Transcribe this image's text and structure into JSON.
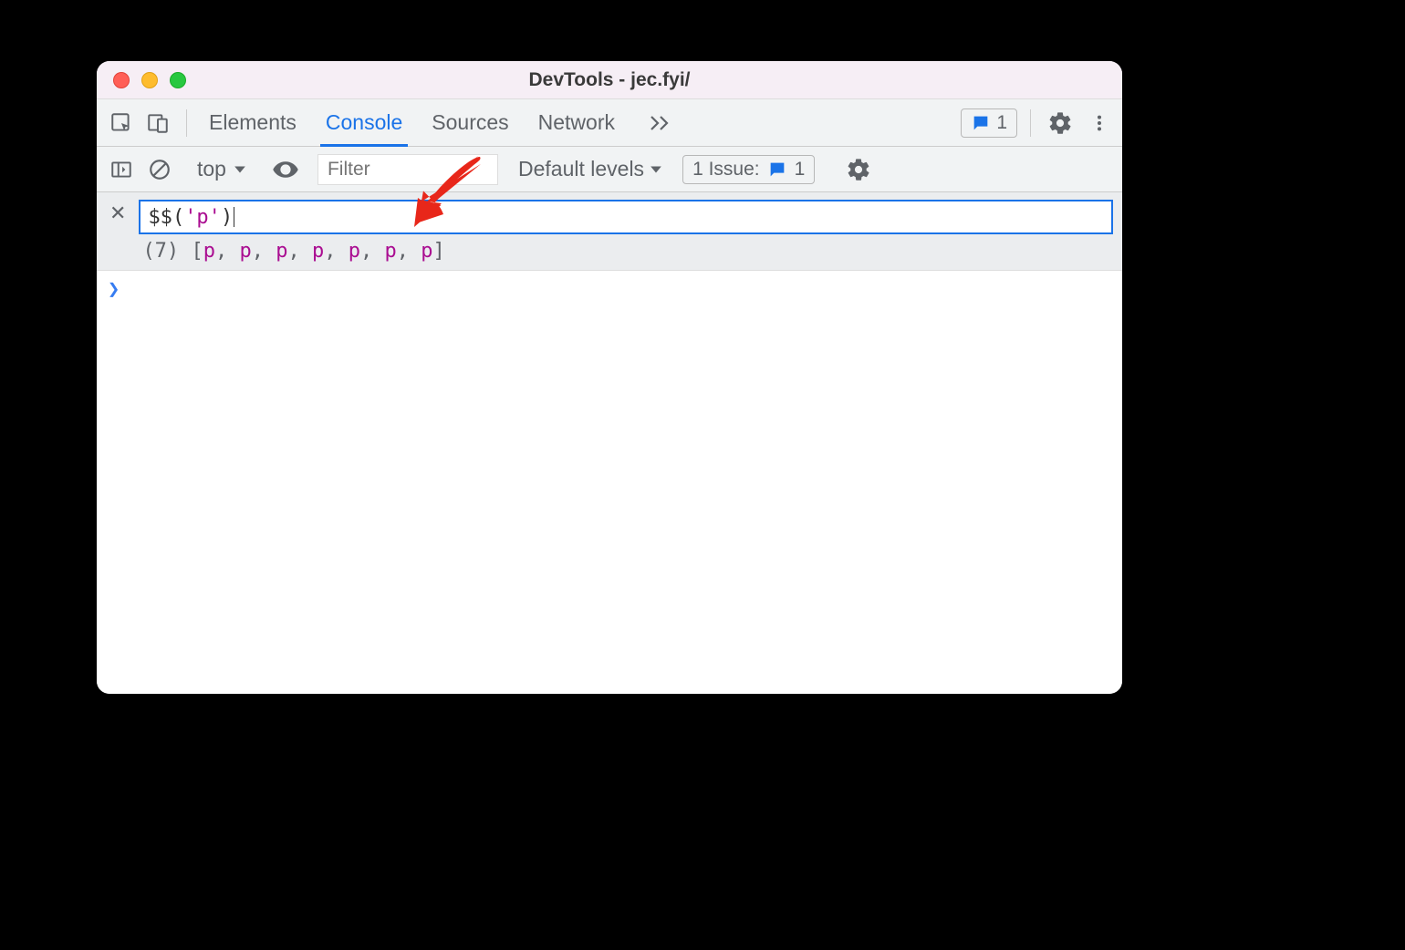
{
  "window": {
    "title": "DevTools - jec.fyi/"
  },
  "tabs": {
    "t0": "Elements",
    "t1": "Console",
    "t2": "Sources",
    "t3": "Network"
  },
  "toolbar": {
    "feedback_count": "1"
  },
  "console_toolbar": {
    "context": "top",
    "filter_placeholder": "Filter",
    "levels": "Default levels",
    "issue_label": "1 Issue:",
    "issue_count": "1"
  },
  "eager": {
    "input_raw": "$$('p')",
    "input_dollar": "$$",
    "input_p1": "(",
    "input_str": "'p'",
    "input_p2": ")",
    "result_count": "(7)",
    "result_open": "[",
    "result_close": "]",
    "elems": [
      "p",
      "p",
      "p",
      "p",
      "p",
      "p",
      "p"
    ]
  },
  "prompt": {
    "chevron": "❯"
  }
}
